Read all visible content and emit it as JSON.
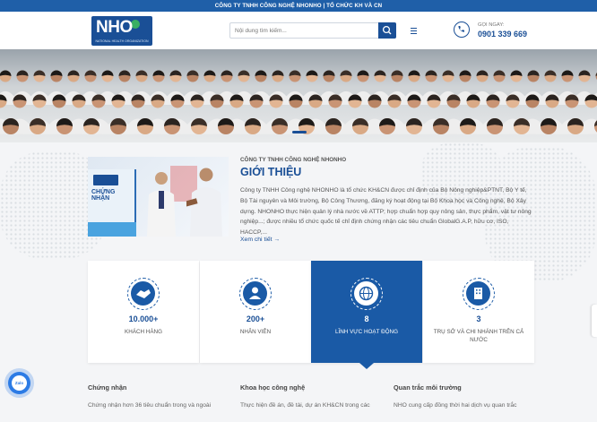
{
  "topbar": {
    "text": "CÔNG TY TNHH CÔNG NGHỆ NHONHO | TỔ CHỨC KH VÀ CN"
  },
  "header": {
    "logo_text": "NHO",
    "logo_subtitle": "NATIONAL HEALTH ORGANIZATION",
    "search_placeholder": "Nội dung tìm kiếm...",
    "call_label": "GỌI NGAY:",
    "call_number": "0901 339 669"
  },
  "intro": {
    "company_label": "CÔNG TY TNHH CÔNG NGHỆ NHONHO",
    "title": "GIỚI THIỆU",
    "text": "Công ty TNHH Công nghệ NHONHO là tổ chức KH&CN được chỉ định của Bộ Nông nghiệp&PTNT, Bộ Y tế, Bộ Tài nguyên và Môi trường, Bộ Công Thương, đăng ký hoạt động tại Bộ Khoa học và Công nghệ, Bộ Xây dựng. NHONHO thực hiện quản lý nhà nước về ATTP; hợp chuẩn hợp quy nông sản, thực phẩm, vật tư nông nghiệp...; được nhiều tổ chức quốc tế chỉ định chứng nhận các tiêu chuẩn GlobalG.A.P, hữu cơ, ISO, HACCP,...",
    "read_more": "Xem chi tiết →",
    "image_board_title": "CHỨNG NHẬN"
  },
  "stats": [
    {
      "icon": "handshake-icon",
      "value": "10.000+",
      "label": "KHÁCH HÀNG"
    },
    {
      "icon": "staff-icon",
      "value": "200+",
      "label": "NHÂN VIÊN"
    },
    {
      "icon": "globe-icon",
      "value": "8",
      "label": "LĨNH VỰC HOẠT ĐỘNG"
    },
    {
      "icon": "building-icon",
      "value": "3",
      "label": "TRỤ SỞ VÀ CHI NHÁNH TRÊN CẢ NƯỚC"
    }
  ],
  "services": [
    {
      "title": "Chứng nhận",
      "text": "Chứng nhận hơn 36 tiêu chuẩn trong và ngoài"
    },
    {
      "title": "Khoa học công nghệ",
      "text": "Thực hiện đề án, đề tài, dự án KH&CN trong các"
    },
    {
      "title": "Quan trắc môi trường",
      "text": "NHO cung cấp đồng thời hai dịch vụ quan trắc"
    }
  ],
  "zalo_label": "Zalo",
  "colors": {
    "primary": "#1a5aa6",
    "topbar": "#1f5fa8",
    "background": "#f4f5f7"
  }
}
